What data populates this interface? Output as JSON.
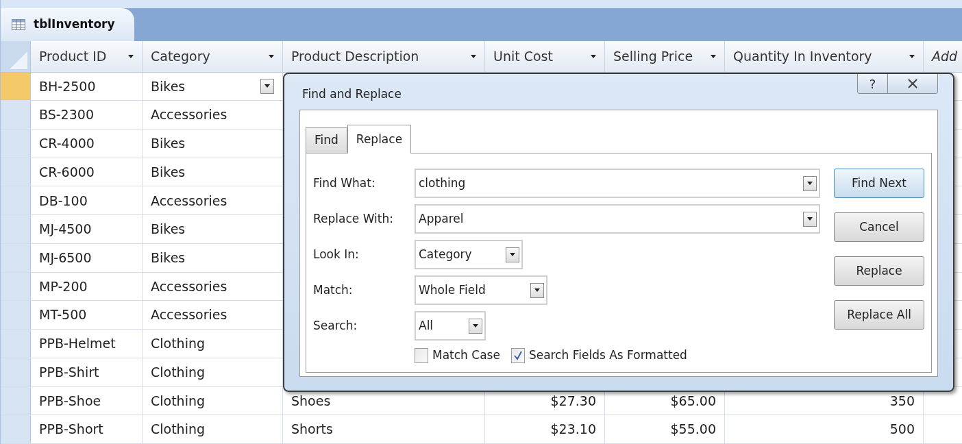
{
  "document_tab": {
    "title": "tblInventory"
  },
  "table": {
    "columns": [
      {
        "label": "Product ID",
        "has_menu": true
      },
      {
        "label": "Category",
        "has_menu": true
      },
      {
        "label": "Product Description",
        "has_menu": true
      },
      {
        "label": "Unit Cost",
        "has_menu": true
      },
      {
        "label": "Selling Price",
        "has_menu": true
      },
      {
        "label": "Quantity In Inventory",
        "has_menu": true
      },
      {
        "label": "Add",
        "has_menu": false
      }
    ],
    "rows": [
      {
        "selected": true,
        "cells": [
          "BH-2500",
          "Bikes"
        ]
      },
      {
        "selected": false,
        "cells": [
          "BS-2300",
          "Accessories"
        ]
      },
      {
        "selected": false,
        "cells": [
          "CR-4000",
          "Bikes"
        ]
      },
      {
        "selected": false,
        "cells": [
          "CR-6000",
          "Bikes"
        ]
      },
      {
        "selected": false,
        "cells": [
          "DB-100",
          "Accessories"
        ]
      },
      {
        "selected": false,
        "cells": [
          "MJ-4500",
          "Bikes"
        ]
      },
      {
        "selected": false,
        "cells": [
          "MJ-6500",
          "Bikes"
        ]
      },
      {
        "selected": false,
        "cells": [
          "MP-200",
          "Accessories"
        ]
      },
      {
        "selected": false,
        "cells": [
          "MT-500",
          "Accessories"
        ]
      },
      {
        "selected": false,
        "cells": [
          "PPB-Helmet",
          "Clothing"
        ]
      },
      {
        "selected": false,
        "cells": [
          "PPB-Shirt",
          "Clothing"
        ]
      },
      {
        "selected": false,
        "cells": [
          "PPB-Shoe",
          "Clothing",
          "Shoes",
          "$27.30",
          "$65.00",
          "350"
        ]
      },
      {
        "selected": false,
        "cells": [
          "PPB-Short",
          "Clothing",
          "Shorts",
          "$23.10",
          "$55.00",
          "500"
        ]
      }
    ]
  },
  "dialog": {
    "title": "Find and Replace",
    "help": "?",
    "tabs": [
      {
        "label": "Find",
        "selected": false
      },
      {
        "label": "Replace",
        "selected": true
      }
    ],
    "fields": [
      {
        "label": "Find What:",
        "value": "clothing",
        "kind": "wide"
      },
      {
        "label": "Replace With:",
        "value": "Apparel",
        "kind": "wide"
      },
      {
        "label": "Look In:",
        "value": "Category",
        "kind": "medium"
      },
      {
        "label": "Match:",
        "value": "Whole Field",
        "kind": "large"
      },
      {
        "label": "Search:",
        "value": "All",
        "kind": "small"
      }
    ],
    "checkboxes": [
      {
        "label": "Match Case",
        "checked": false
      },
      {
        "label": "Search Fields As Formatted",
        "checked": true
      }
    ],
    "buttons": [
      {
        "label": "Find Next",
        "default": true
      },
      {
        "label": "Cancel",
        "default": false
      },
      {
        "label": "Replace",
        "default": false
      },
      {
        "label": "Replace All",
        "default": false
      }
    ]
  }
}
